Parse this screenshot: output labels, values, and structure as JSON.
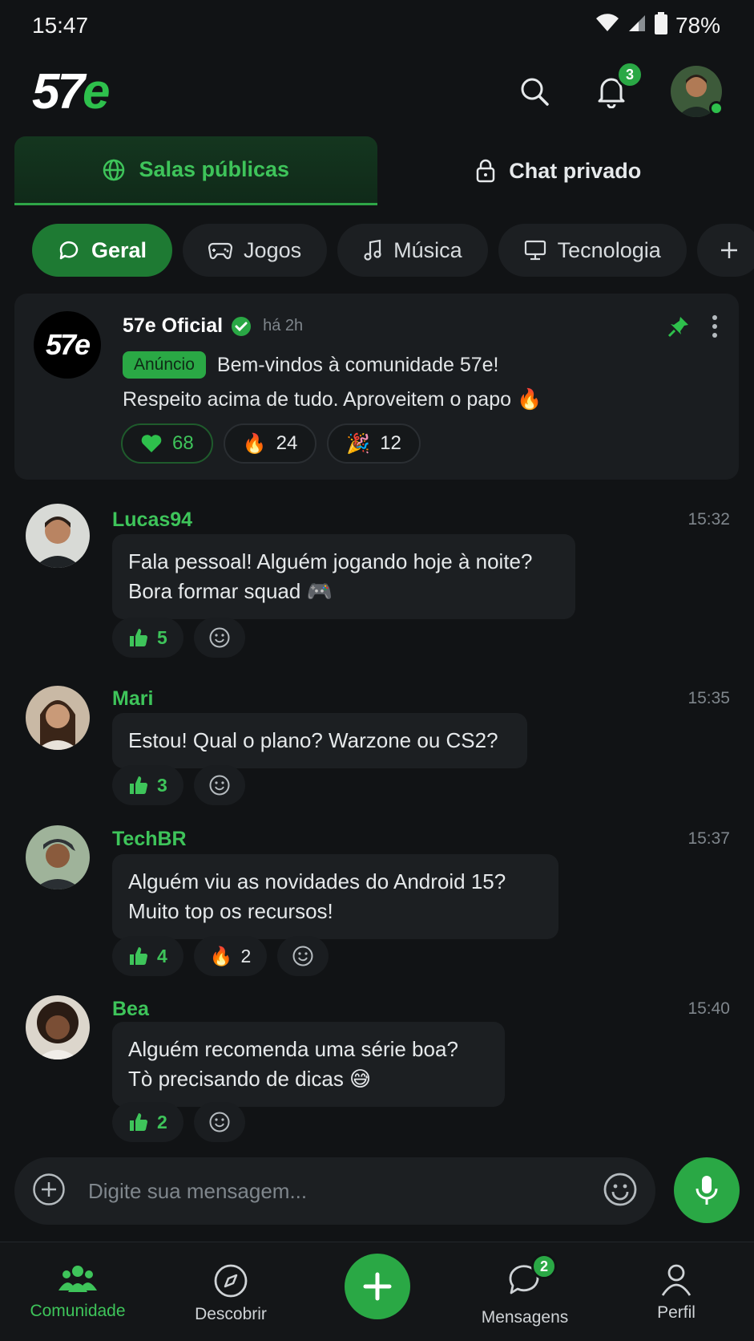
{
  "status_bar": {
    "time": "15:47",
    "battery": "78%"
  },
  "header": {
    "logo_main": "57",
    "logo_accent": "e",
    "notifications_count": "3"
  },
  "main_tabs": [
    {
      "label": "Salas públicas",
      "icon": "globe-icon",
      "active": true
    },
    {
      "label": "Chat privado",
      "icon": "lock-icon",
      "active": false
    }
  ],
  "categories": [
    {
      "label": "Geral",
      "icon": "chat-bubble-icon",
      "active": true
    },
    {
      "label": "Jogos",
      "icon": "gamepad-icon",
      "active": false
    },
    {
      "label": "Música",
      "icon": "music-note-icon",
      "active": false
    },
    {
      "label": "Tecnologia",
      "icon": "monitor-icon",
      "active": false
    }
  ],
  "pinned": {
    "author": "57e Oficial",
    "avatar_text": "57e",
    "time": "há 2h",
    "tag": "Anúncio",
    "line1": "Bem-vindos à comunidade 57e!",
    "line2": "Respeito acima de tudo. Aproveitem o papo 🔥",
    "reactions": [
      {
        "emoji": "heart",
        "count": "68"
      },
      {
        "emoji": "🔥",
        "count": "24"
      },
      {
        "emoji": "🎉",
        "count": "12"
      }
    ]
  },
  "messages": [
    {
      "author": "Lucas94",
      "time": "15:32",
      "lines": [
        "Fala pessoal! Alguém jogando hoje à noite?",
        "Bora formar squad 🎮"
      ],
      "likes": "5"
    },
    {
      "author": "Mari",
      "time": "15:35",
      "lines": [
        "Estou! Qual o plano? Warzone ou CS2?"
      ],
      "likes": "3"
    },
    {
      "author": "TechBR",
      "time": "15:37",
      "lines": [
        "Alguém viu as novidades do Android 15?",
        "Muito top os recursos!"
      ],
      "likes": "4",
      "fire": "2"
    },
    {
      "author": "Bea",
      "time": "15:40",
      "lines": [
        "Alguém recomenda uma série boa?",
        "Tò precisando de dicas 😅"
      ],
      "likes": "2"
    }
  ],
  "composer": {
    "placeholder": "Digite sua mensagem..."
  },
  "bottom_nav": [
    {
      "label": "Comunidade",
      "icon": "community-icon",
      "active": true
    },
    {
      "label": "Descobrir",
      "icon": "compass-icon",
      "active": false
    },
    {
      "label": "Mensagens",
      "icon": "messages-icon",
      "active": false,
      "badge": "2"
    },
    {
      "label": "Perfil",
      "icon": "profile-icon",
      "active": false
    }
  ],
  "colors": {
    "accent": "#2aa845",
    "background": "#111315",
    "surface": "#1c1f22"
  }
}
